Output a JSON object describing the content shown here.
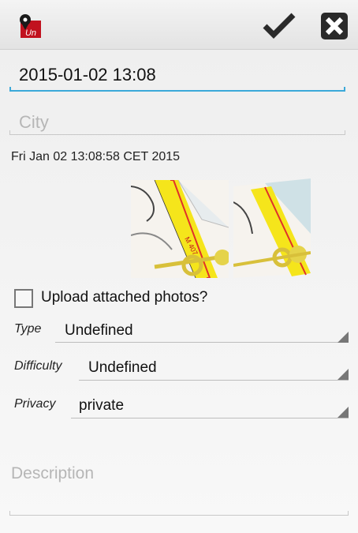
{
  "actionbar": {
    "app_icon": "app-logo-icon",
    "app_icon_text": "Un",
    "done_icon": "checkmark-icon",
    "cancel_icon": "close-icon"
  },
  "form": {
    "name_value": "2015-01-02 13:08",
    "city_placeholder": "City",
    "date_text": "Fri Jan 02 13:08:58 CET 2015",
    "upload_label": "Upload attached photos?",
    "upload_checked": false,
    "type_label": "Type",
    "type_value": "Undefined",
    "difficulty_label": "Difficulty",
    "difficulty_value": "Undefined",
    "privacy_label": "Privacy",
    "privacy_value": "private",
    "description_placeholder": "Description"
  },
  "map_thumbnails": {
    "map1_label": "M 407",
    "colors": {
      "road": "#f5e51b",
      "road_edge": "#e0302a",
      "land": "#f6f3ee",
      "water": "#cfe1e6"
    }
  },
  "colors": {
    "accent": "#3ba9d9"
  }
}
